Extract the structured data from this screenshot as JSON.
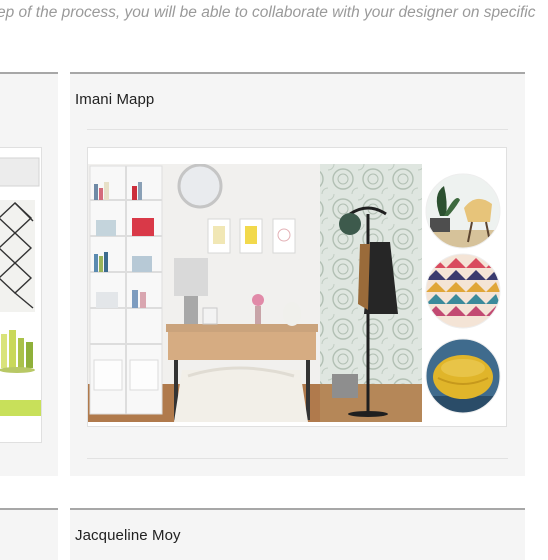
{
  "intro": {
    "text": "ep of the process, you will be able to collaborate with your designer on specific"
  },
  "designers": [
    {
      "name": "Imani Mapp"
    },
    {
      "name": "Jacqueline Moy"
    }
  ],
  "colors": {
    "card_background": "#f5f5f5",
    "card_border": "#a7a7a7",
    "accent_lime": "#c8e05a",
    "pouf_yellow": "#e0b52a"
  }
}
